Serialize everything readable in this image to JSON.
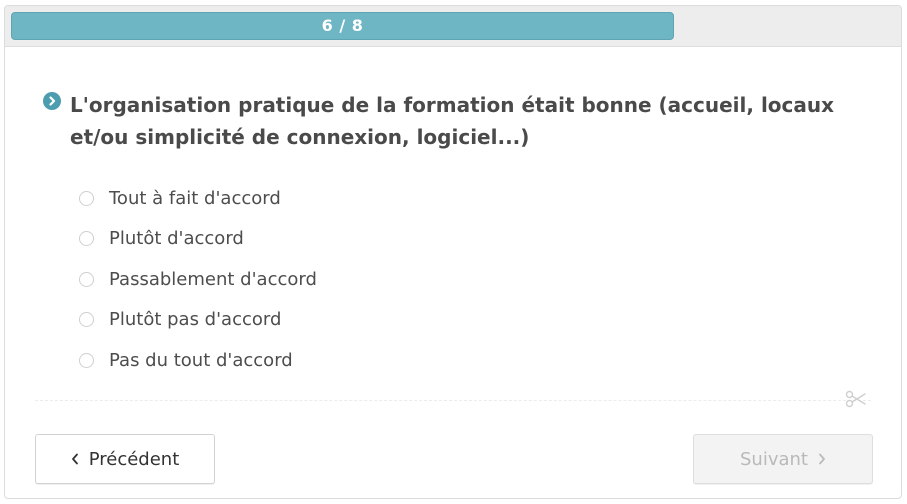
{
  "progress": {
    "label": "6 / 8",
    "current": 6,
    "total": 8,
    "fill_fraction": 0.75
  },
  "question": {
    "text": "L'organisation pratique de la formation était bonne (accueil, locaux et/ou simplicité de connexion, logiciel...)",
    "icon": "chevron-right-circle-icon"
  },
  "options": [
    {
      "label": "Tout à fait d'accord",
      "selected": false
    },
    {
      "label": "Plutôt d'accord",
      "selected": false
    },
    {
      "label": "Passablement d'accord",
      "selected": false
    },
    {
      "label": "Plutôt pas d'accord",
      "selected": false
    },
    {
      "label": "Pas du tout d'accord",
      "selected": false
    }
  ],
  "nav": {
    "prev_label": "Précédent",
    "next_label": "Suivant",
    "next_enabled": false
  },
  "colors": {
    "progress_fill": "#6fb6c4",
    "accent": "#4d9db0",
    "text": "#4a4a4a"
  }
}
